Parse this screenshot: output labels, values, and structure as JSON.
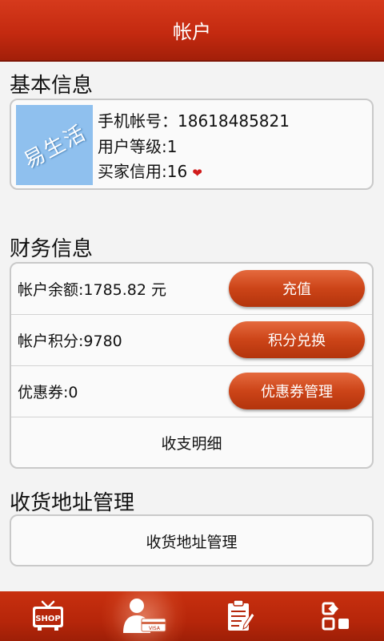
{
  "header": {
    "title": "帐户"
  },
  "basic": {
    "section_title": "基本信息",
    "avatar_text": "易生活",
    "phone": "手机帐号：18618485821",
    "level": "用户等级:1",
    "credit": "买家信用:16"
  },
  "finance": {
    "section_title": "财务信息",
    "rows": [
      {
        "label": "帐户余额:1785.82 元",
        "button": "充值"
      },
      {
        "label": "帐户积分:9780",
        "button": "积分兑换"
      },
      {
        "label": "优惠券:0",
        "button": "优惠券管理"
      }
    ],
    "details_label": "收支明细"
  },
  "address": {
    "section_title": "收货地址管理",
    "button_label": "收货地址管理"
  },
  "tabbar": {
    "items": [
      {
        "icon": "shop-tv-icon",
        "label": "SHOP"
      },
      {
        "icon": "account-card-icon",
        "label": "VISA"
      },
      {
        "icon": "clipboard-icon"
      },
      {
        "icon": "grid-apps-icon"
      }
    ],
    "active_index": 1
  },
  "colors": {
    "header": "#c42a10",
    "button": "#cc4418",
    "tabbar": "#b6260a",
    "avatar": "#8fc0ee",
    "heart": "#d11b1b"
  }
}
